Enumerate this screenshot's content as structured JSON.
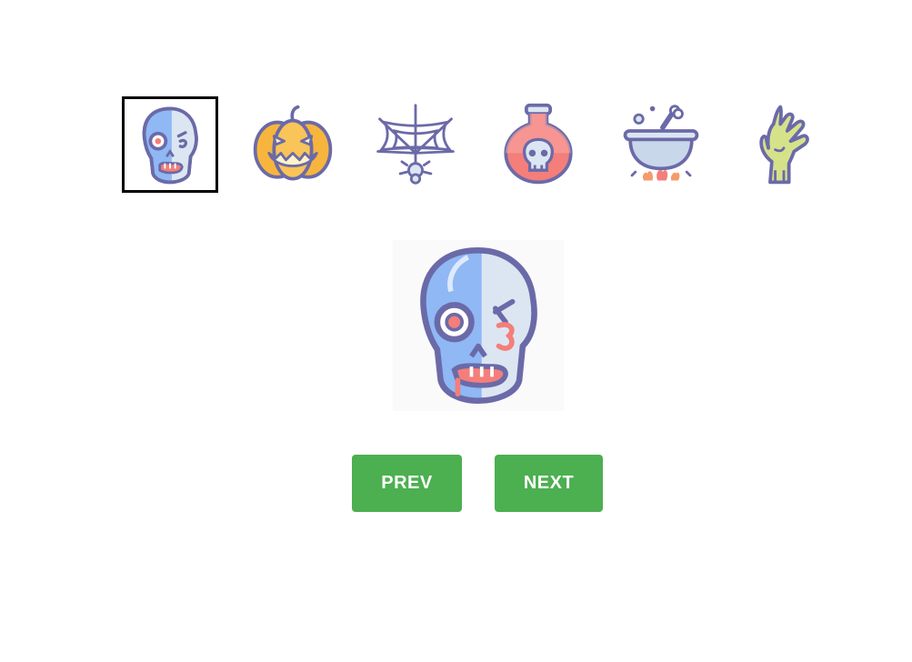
{
  "gallery": {
    "thumbnails": [
      {
        "icon": "skull-icon",
        "selected": true
      },
      {
        "icon": "pumpkin-icon",
        "selected": false
      },
      {
        "icon": "spider-web-icon",
        "selected": false
      },
      {
        "icon": "poison-potion-icon",
        "selected": false
      },
      {
        "icon": "cauldron-icon",
        "selected": false
      },
      {
        "icon": "zombie-hand-icon",
        "selected": false
      }
    ],
    "preview_icon": "skull-icon"
  },
  "controls": {
    "prev_label": "PREV",
    "next_label": "NEXT"
  },
  "colors": {
    "button_bg": "#4caf50",
    "outline": "#6b6aa8",
    "skull_blue": "#8fb8f5",
    "skull_light": "#dce6f2",
    "pumpkin": "#f7b53d",
    "potion": "#f47e7a",
    "flame": "#f59a6a",
    "zombie": "#d6e28a"
  }
}
